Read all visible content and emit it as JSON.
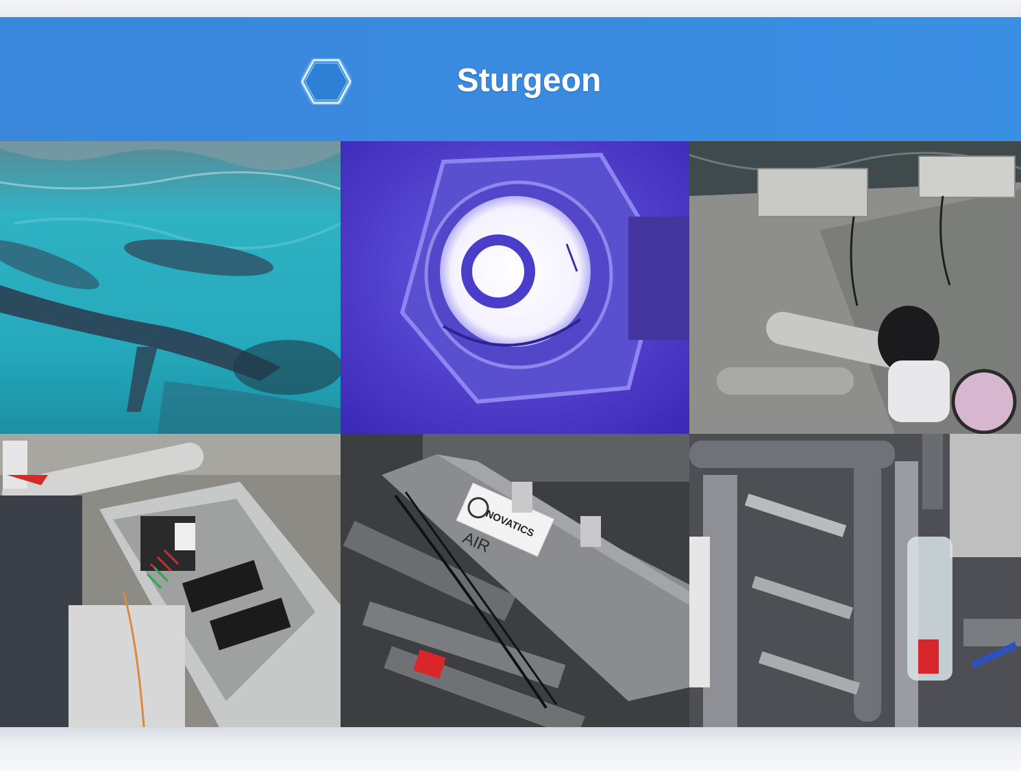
{
  "header": {
    "title": "Sturgeon"
  },
  "photos": [
    {
      "name": "sturgeon-tank-photo"
    },
    {
      "name": "uv-lamp-photo"
    },
    {
      "name": "technician-tank-photo"
    },
    {
      "name": "control-box-photo"
    },
    {
      "name": "novatics-pipe-photo"
    },
    {
      "name": "pipe-frame-photo"
    }
  ],
  "logos": {
    "pipe_label_brand": "NOVATICS",
    "pipe_label_handwritten": "AIR",
    "ballast_brand": "NOVATICS"
  },
  "colors": {
    "header": "#3a87dc",
    "water": "#2fb7c6",
    "uv": "#4a34c8"
  }
}
